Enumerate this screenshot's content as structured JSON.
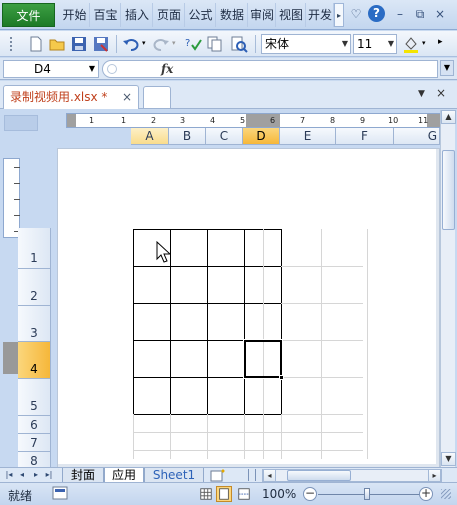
{
  "ribbon": {
    "file_tab": "文件",
    "tabs": [
      "开始",
      "百宝",
      "插入",
      "页面",
      "公式",
      "数据",
      "审阅",
      "视图",
      "开发"
    ]
  },
  "toolbar": {
    "font_name": "宋体",
    "font_size": "11"
  },
  "formula_bar": {
    "name_box": "D4",
    "fx_label": "fx",
    "formula": ""
  },
  "document": {
    "tab_label": "录制视频用.xlsx *",
    "close_glyph": "×"
  },
  "ruler": {
    "numbers": [
      "1",
      "1",
      "2",
      "3",
      "4",
      "5",
      "6",
      "7",
      "8",
      "9",
      "10",
      "11"
    ]
  },
  "columns": [
    {
      "label": "A",
      "state": "hover"
    },
    {
      "label": "B",
      "state": "normal"
    },
    {
      "label": "C",
      "state": "normal"
    },
    {
      "label": "D",
      "state": "selected"
    },
    {
      "label": "E",
      "state": "normal"
    },
    {
      "label": "F",
      "state": "normal"
    },
    {
      "label": "G",
      "state": "normal"
    }
  ],
  "rows": [
    {
      "label": "1",
      "state": "normal"
    },
    {
      "label": "2",
      "state": "normal"
    },
    {
      "label": "3",
      "state": "normal"
    },
    {
      "label": "4",
      "state": "selected"
    },
    {
      "label": "5",
      "state": "normal"
    },
    {
      "label": "6",
      "state": "normal"
    },
    {
      "label": "7",
      "state": "normal"
    },
    {
      "label": "8",
      "state": "normal"
    }
  ],
  "active_cell": "D4",
  "sheets": [
    {
      "label": "封面",
      "active": false
    },
    {
      "label": "应用",
      "active": true
    },
    {
      "label": "Sheet1",
      "active": false
    }
  ],
  "status": {
    "ready": "就绪",
    "zoom": "100%",
    "zoom_value": 100
  },
  "colors": {
    "selected_header": "#f6b73a",
    "file_tab": "#1d7a27",
    "doc_tab_text": "#c0401c"
  }
}
